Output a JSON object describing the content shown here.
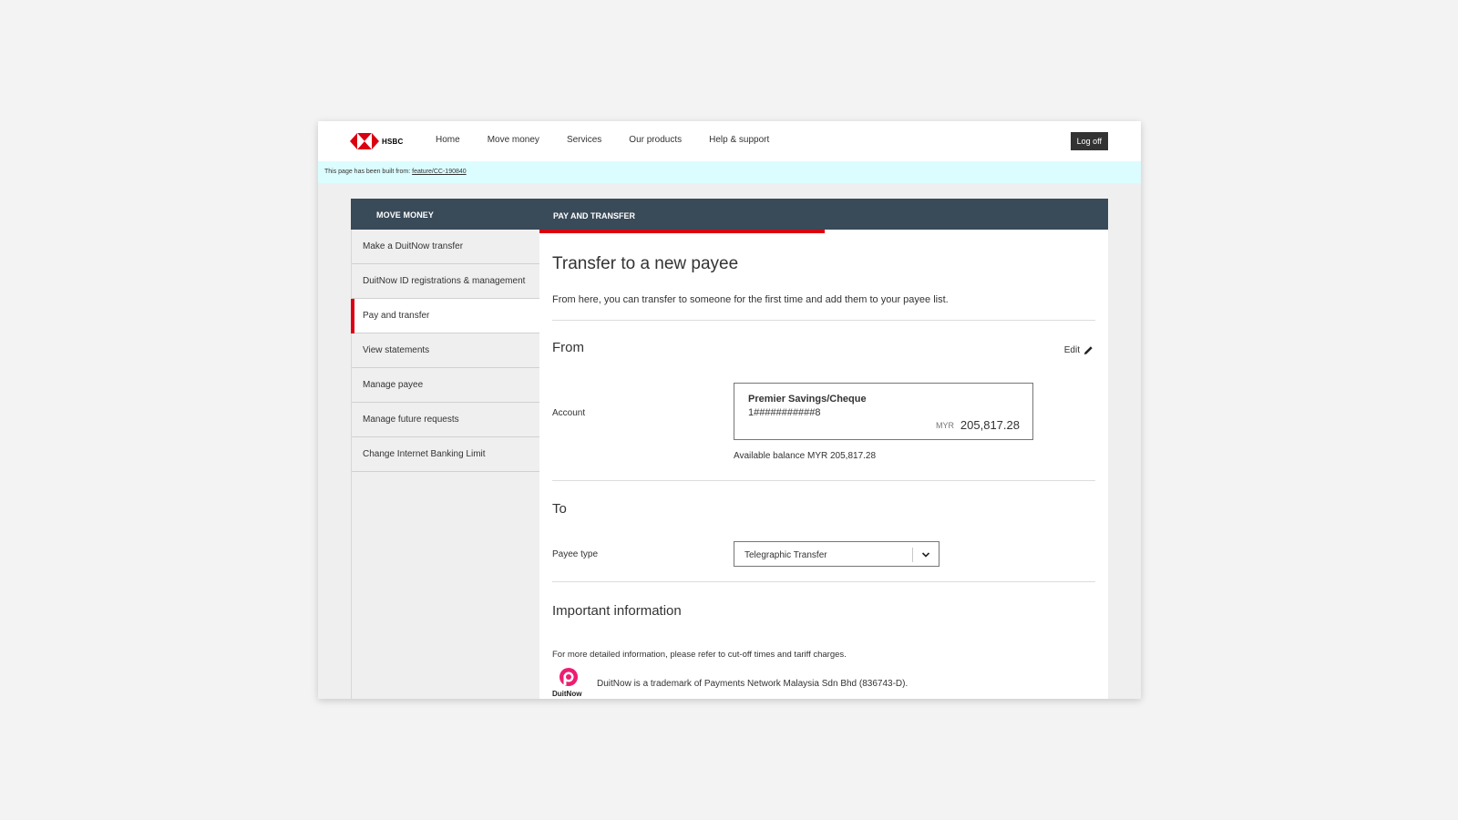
{
  "brand": {
    "name": "HSBC",
    "accent": "#db0011",
    "header_bg": "#394a58"
  },
  "nav": {
    "items": [
      "Home",
      "Move money",
      "Services",
      "Our products",
      "Help & support"
    ],
    "logoff_label": "Log off"
  },
  "build_bar": {
    "text": "This page has been built from: ",
    "link": "feature/CC-190840"
  },
  "header": {
    "left": "MOVE MONEY",
    "right": "PAY AND TRANSFER"
  },
  "sidebar": {
    "items": [
      {
        "label": "Make a DuitNow transfer"
      },
      {
        "label": "DuitNow ID registrations & management"
      },
      {
        "label": "Pay and transfer",
        "active": true
      },
      {
        "label": "View statements"
      },
      {
        "label": "Manage payee"
      },
      {
        "label": "Manage future requests"
      },
      {
        "label": "Change Internet Banking Limit"
      }
    ]
  },
  "main": {
    "title": "Transfer to a new payee",
    "intro": "From here, you can transfer to someone for the first time and add them to your payee list.",
    "from": {
      "heading": "From",
      "edit_label": "Edit",
      "account_label": "Account",
      "account_name": "Premier Savings/Cheque",
      "account_number": "1###########8",
      "currency": "MYR",
      "balance": "205,817.28",
      "available": "Available balance MYR 205,817.28"
    },
    "to": {
      "heading": "To",
      "payee_type_label": "Payee type",
      "payee_type_value": "Telegraphic Transfer"
    },
    "important": {
      "heading": "Important information",
      "text": "For more detailed information, please refer to cut-off times and tariff charges.",
      "duitnow_logo_text": "DuitNow",
      "duitnow_text": "DuitNow is a trademark of Payments Network Malaysia Sdn Bhd (836743-D)."
    }
  }
}
